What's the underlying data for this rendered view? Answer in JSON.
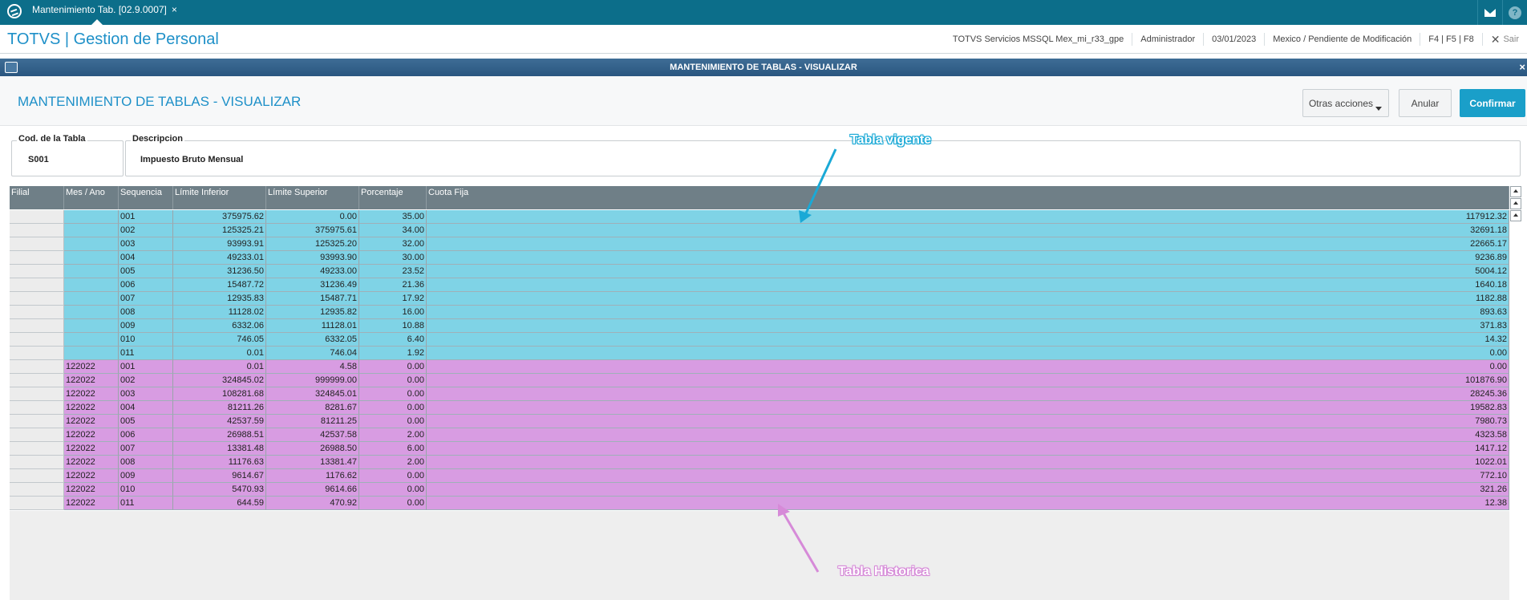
{
  "topbar": {
    "tab_label": "Mantenimiento Tab. [02.9.0007]",
    "tab_close": "×",
    "help_glyph": "?"
  },
  "header": {
    "app_title": "TOTVS | Gestion de Personal",
    "environment": "TOTVS Servicios MSSQL Mex_mi_r33_gpe",
    "user": "Administrador",
    "date": "03/01/2023",
    "status": "Mexico / Pendiente de Modificación",
    "shortcuts": "F4 | F5 | F8",
    "exit_glyph": "✕",
    "exit_label": "Sair"
  },
  "dialog": {
    "bar_title": "MANTENIMIENTO DE TABLAS - VISUALIZAR",
    "close_glyph": "×",
    "title": "MANTENIMIENTO DE TABLAS - VISUALIZAR",
    "buttons": {
      "otras": "Otras acciones",
      "anular": "Anular",
      "confirmar": "Confirmar"
    }
  },
  "fields": {
    "cod_label": "Cod. de la Tabla",
    "cod_value": "S001",
    "desc_label": "Descripcion",
    "desc_value": "Impuesto Bruto Mensual"
  },
  "grid": {
    "columns": [
      "Filial",
      "Mes / Ano",
      "Sequencia",
      "Límite Inferior",
      "Límite Superior",
      "Porcentaje",
      "Cuota Fija"
    ],
    "current_rows": [
      [
        "",
        "",
        "001",
        "375975.62",
        "0.00",
        "35.00",
        "117912.32"
      ],
      [
        "",
        "",
        "002",
        "125325.21",
        "375975.61",
        "34.00",
        "32691.18"
      ],
      [
        "",
        "",
        "003",
        "93993.91",
        "125325.20",
        "32.00",
        "22665.17"
      ],
      [
        "",
        "",
        "004",
        "49233.01",
        "93993.90",
        "30.00",
        "9236.89"
      ],
      [
        "",
        "",
        "005",
        "31236.50",
        "49233.00",
        "23.52",
        "5004.12"
      ],
      [
        "",
        "",
        "006",
        "15487.72",
        "31236.49",
        "21.36",
        "1640.18"
      ],
      [
        "",
        "",
        "007",
        "12935.83",
        "15487.71",
        "17.92",
        "1182.88"
      ],
      [
        "",
        "",
        "008",
        "11128.02",
        "12935.82",
        "16.00",
        "893.63"
      ],
      [
        "",
        "",
        "009",
        "6332.06",
        "11128.01",
        "10.88",
        "371.83"
      ],
      [
        "",
        "",
        "010",
        "746.05",
        "6332.05",
        "6.40",
        "14.32"
      ],
      [
        "",
        "",
        "011",
        "0.01",
        "746.04",
        "1.92",
        "0.00"
      ]
    ],
    "historic_rows": [
      [
        "",
        "122022",
        "001",
        "0.01",
        "4.58",
        "0.00",
        "0.00"
      ],
      [
        "",
        "122022",
        "002",
        "324845.02",
        "999999.00",
        "0.00",
        "101876.90"
      ],
      [
        "",
        "122022",
        "003",
        "108281.68",
        "324845.01",
        "0.00",
        "28245.36"
      ],
      [
        "",
        "122022",
        "004",
        "81211.26",
        "8281.67",
        "0.00",
        "19582.83"
      ],
      [
        "",
        "122022",
        "005",
        "42537.59",
        "81211.25",
        "0.00",
        "7980.73"
      ],
      [
        "",
        "122022",
        "006",
        "26988.51",
        "42537.58",
        "2.00",
        "4323.58"
      ],
      [
        "",
        "122022",
        "007",
        "13381.48",
        "26988.50",
        "6.00",
        "1417.12"
      ],
      [
        "",
        "122022",
        "008",
        "11176.63",
        "13381.47",
        "2.00",
        "1022.01"
      ],
      [
        "",
        "122022",
        "009",
        "9614.67",
        "1176.62",
        "0.00",
        "772.10"
      ],
      [
        "",
        "122022",
        "010",
        "5470.93",
        "9614.66",
        "0.00",
        "321.26"
      ],
      [
        "",
        "122022",
        "011",
        "644.59",
        "470.92",
        "0.00",
        "12.38"
      ]
    ]
  },
  "annotations": {
    "current_label": "Tabla vigente",
    "historic_label": "Tabla Historica"
  },
  "colors": {
    "current_row": "#7fd3e6",
    "historic_row": "#d89ce2",
    "accent": "#1a9fc9"
  }
}
